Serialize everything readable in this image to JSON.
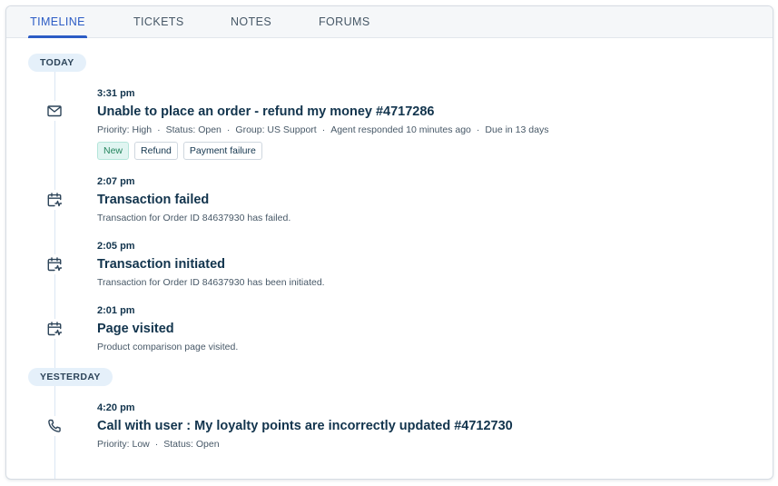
{
  "tabs": [
    {
      "label": "TIMELINE",
      "active": true
    },
    {
      "label": "TICKETS",
      "active": false
    },
    {
      "label": "NOTES",
      "active": false
    },
    {
      "label": "FORUMS",
      "active": false
    }
  ],
  "colors": {
    "accent": "#2c5cc5",
    "day_pill_bg": "#e5f0fa",
    "new_tag_bg": "#e0f5f1",
    "new_tag_text": "#24855e"
  },
  "days": [
    {
      "label": "TODAY"
    },
    {
      "label": "YESTERDAY"
    }
  ],
  "entries": [
    {
      "icon": "mail-icon",
      "time": "3:31 pm",
      "title": "Unable to place an order - refund my money #4717286",
      "meta": [
        "Priority: High",
        "Status: Open",
        "Group: US Support",
        "Agent responded 10 minutes ago",
        "Due in 13 days"
      ],
      "tags": [
        "New",
        "Refund",
        "Payment failure"
      ]
    },
    {
      "icon": "calendar-activity-icon",
      "time": "2:07 pm",
      "title": "Transaction failed",
      "description": "Transaction for Order ID 84637930 has failed."
    },
    {
      "icon": "calendar-activity-icon",
      "time": "2:05 pm",
      "title": "Transaction initiated",
      "description": "Transaction for Order ID 84637930 has been initiated."
    },
    {
      "icon": "calendar-activity-icon",
      "time": "2:01 pm",
      "title": "Page visited",
      "description": "Product comparison page visited."
    },
    {
      "icon": "phone-icon",
      "time": "4:20 pm",
      "title": "Call with user : My loyalty points are incorrectly updated #4712730",
      "meta": [
        "Priority: Low",
        "Status: Open"
      ]
    }
  ]
}
